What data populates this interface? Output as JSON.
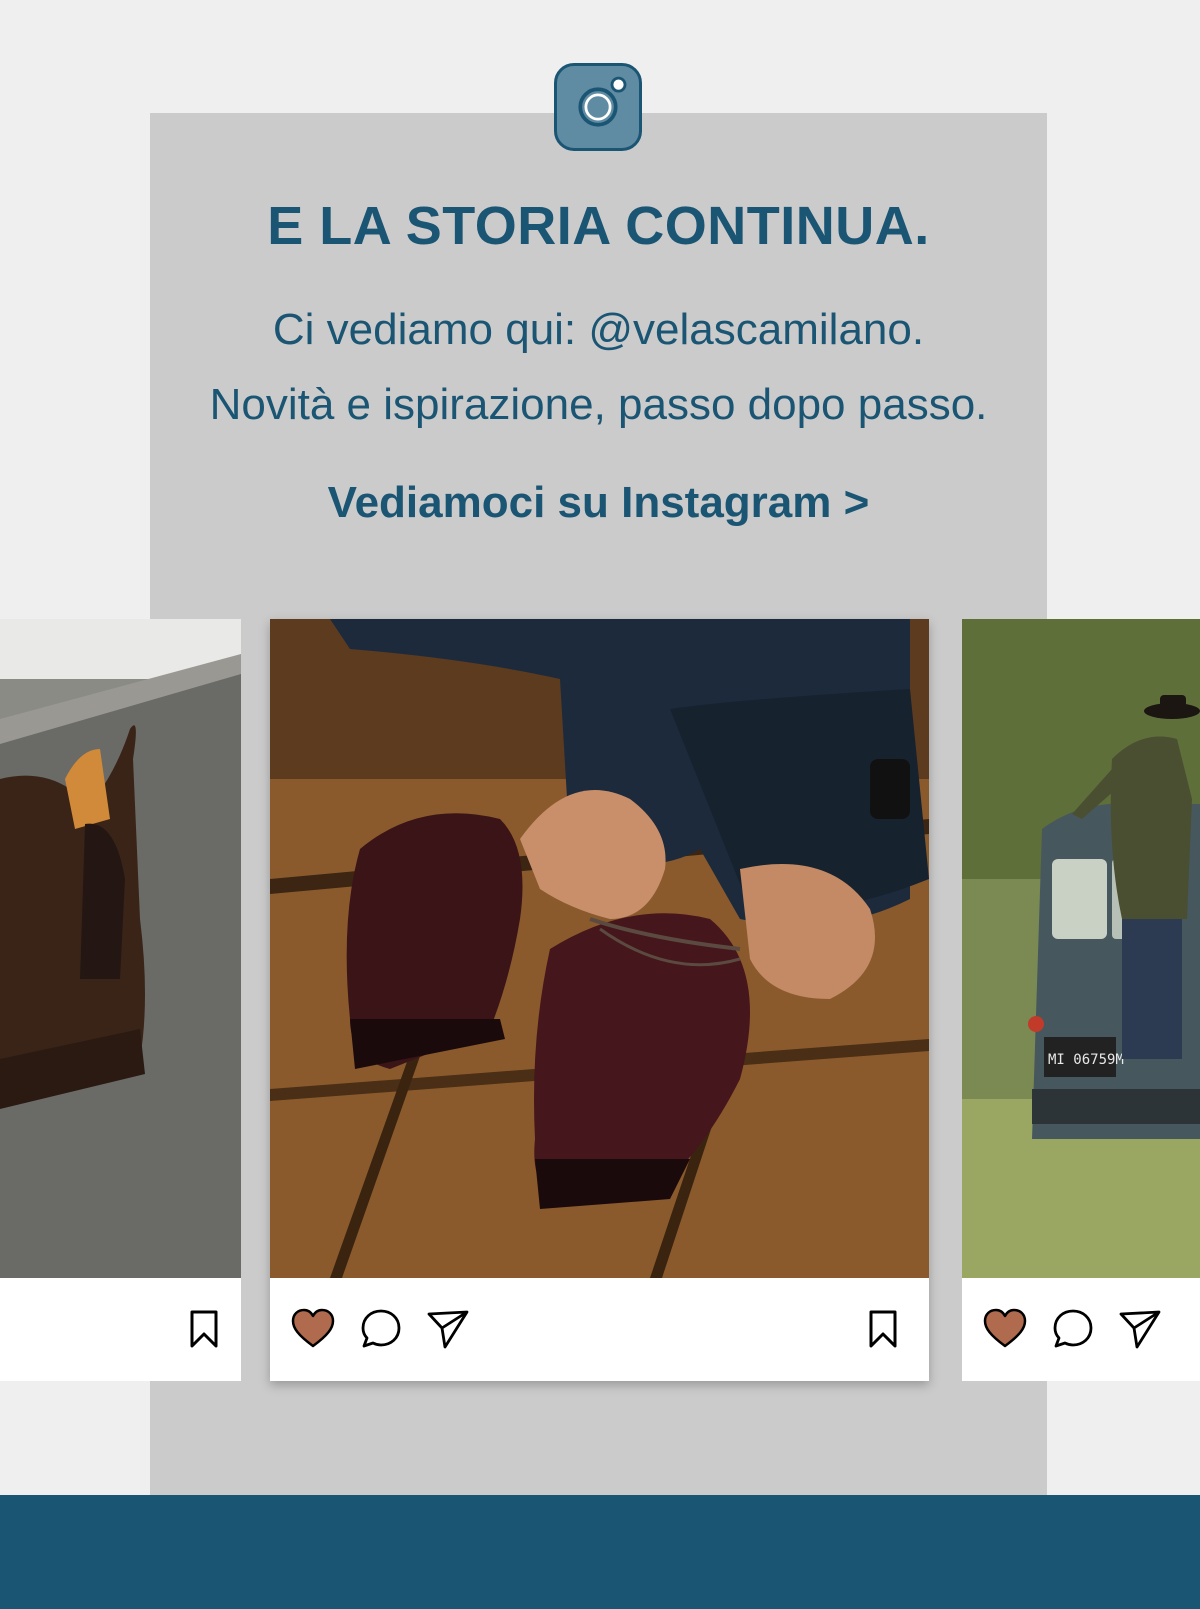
{
  "section": {
    "headline": "E LA STORIA CONTINUA.",
    "subline_1": "Ci vediamo qui: @velascamilano.",
    "subline_2": "Novità e ispirazione, passo dopo passo.",
    "cta_label": "Vediamoci su Instagram >"
  },
  "colors": {
    "brand_blue": "#1b5574",
    "panel_gray": "#cbcbcb",
    "page_bg": "#efefef",
    "like_fill": "#b06a4e"
  },
  "icons": {
    "logo": "instagram-icon",
    "like": "heart-icon",
    "comment": "comment-icon",
    "share": "send-icon",
    "save": "bookmark-icon"
  },
  "posts": [
    {
      "image": "brown chelsea boot on stone step",
      "plate_text": ""
    },
    {
      "image": "man tying laces of burgundy brogues on wooden floor",
      "plate_text": ""
    },
    {
      "image": "man in hat on vintage off-road vehicle in meadow",
      "plate_text": "MI 06759M"
    }
  ]
}
